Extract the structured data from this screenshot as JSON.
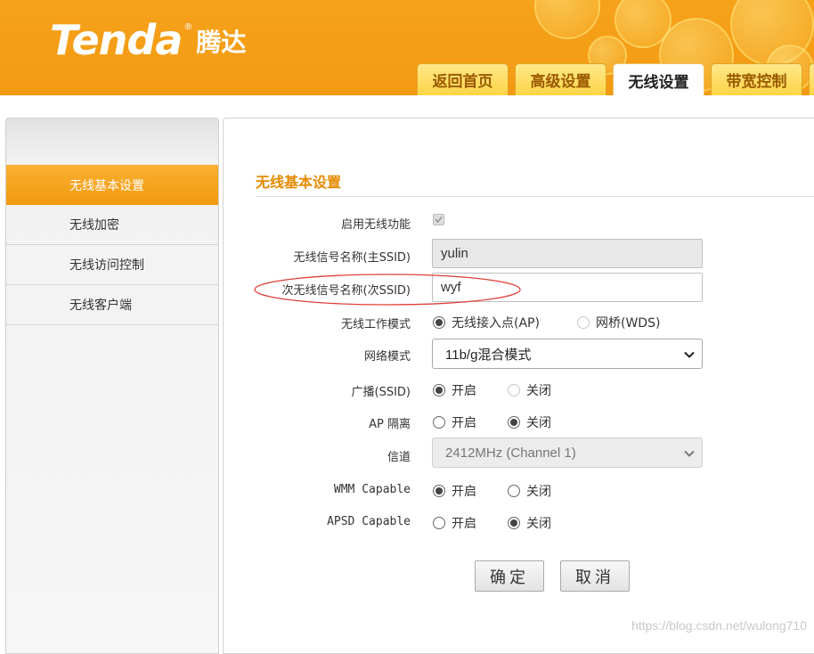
{
  "brand": {
    "logo_text": "Tenda",
    "logo_mark": "®",
    "logo_cn": "腾达"
  },
  "nav_tabs": [
    {
      "label": "返回首页",
      "active": false
    },
    {
      "label": "高级设置",
      "active": false
    },
    {
      "label": "无线设置",
      "active": true
    },
    {
      "label": "带宽控制",
      "active": false
    }
  ],
  "sidebar": {
    "items": [
      {
        "label": "无线基本设置",
        "active": true
      },
      {
        "label": "无线加密",
        "active": false
      },
      {
        "label": "无线访问控制",
        "active": false
      },
      {
        "label": "无线客户端",
        "active": false
      }
    ]
  },
  "main": {
    "section_title": "无线基本设置",
    "enable_wireless": {
      "label": "启用无线功能",
      "checked": true
    },
    "primary_ssid": {
      "label": "无线信号名称(主SSID)",
      "value": "yulin"
    },
    "secondary_ssid": {
      "label": "次无线信号名称(次SSID)",
      "value": "wyf"
    },
    "work_mode": {
      "label": "无线工作模式",
      "options": [
        "无线接入点(AP)",
        "网桥(WDS)"
      ],
      "selected": 0
    },
    "network_mode": {
      "label": "网络模式",
      "value": "11b/g混合模式"
    },
    "broadcast": {
      "label": "广播(SSID)",
      "options": [
        "开启",
        "关闭"
      ],
      "selected": 0
    },
    "ap_isolation": {
      "label": "AP 隔离",
      "options": [
        "开启",
        "关闭"
      ],
      "selected": 1
    },
    "channel": {
      "label": "信道",
      "value": "2412MHz (Channel 1)"
    },
    "wmm": {
      "label": "WMM Capable",
      "options": [
        "开启",
        "关闭"
      ],
      "selected": 0
    },
    "apsd": {
      "label": "APSD Capable",
      "options": [
        "开启",
        "关闭"
      ],
      "selected": 1
    },
    "buttons": {
      "ok": "确定",
      "cancel": "取消"
    }
  },
  "annotation": {
    "color": "#e0403a"
  },
  "watermark": "https://blog.csdn.net/wulong710",
  "colors": {
    "header_orange": "#f39a12",
    "tab_yellow": "#ffd447",
    "title_orange": "#e58a00"
  }
}
